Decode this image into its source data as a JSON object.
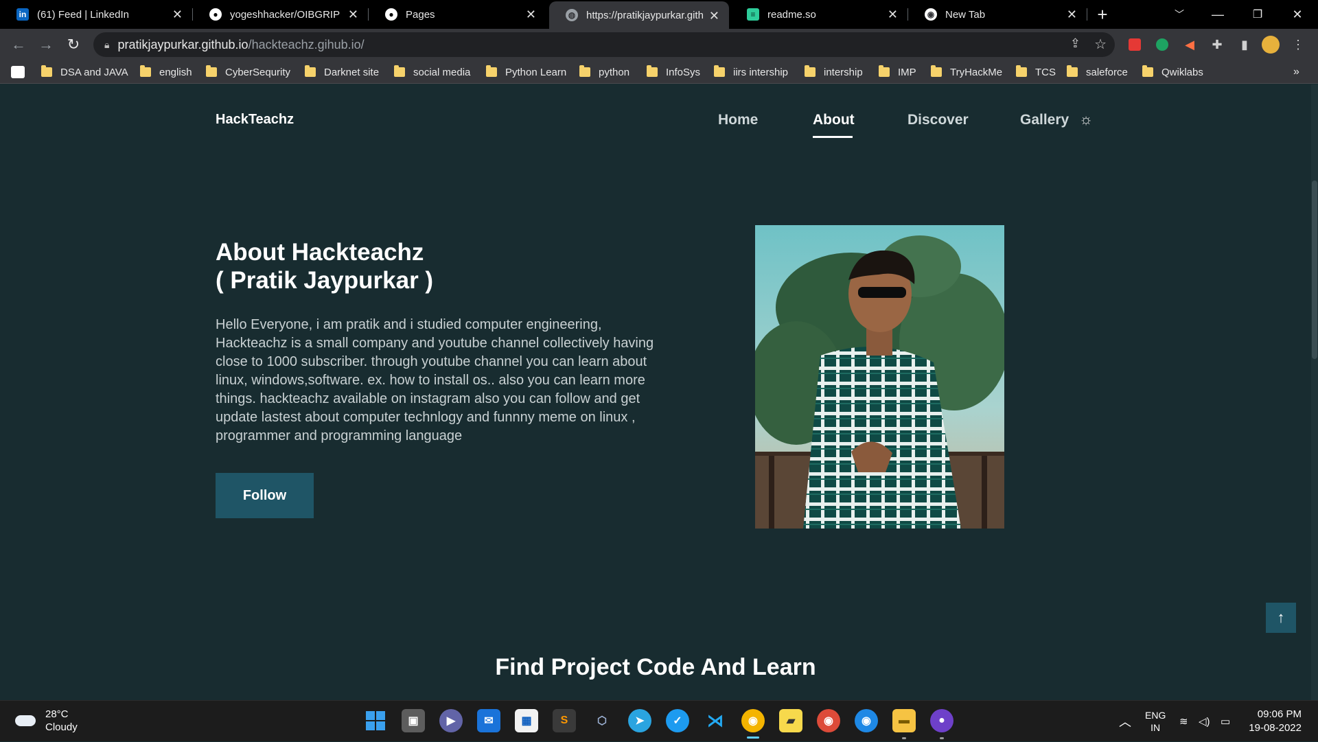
{
  "browser": {
    "tabs": [
      {
        "title": "(61) Feed | LinkedIn",
        "icon": "linkedin-icon"
      },
      {
        "title": "yogeshhacker/OIBGRIP",
        "icon": "github-icon"
      },
      {
        "title": "Pages",
        "icon": "github-icon"
      },
      {
        "title": "https://pratikjaypurkar.github.io/hackteachz.gihub.io/",
        "icon": "globe-icon"
      },
      {
        "title": "readme.so",
        "icon": "readme-icon"
      },
      {
        "title": "New Tab",
        "icon": "chrome-icon"
      }
    ],
    "new_tab_symbol": "+",
    "url_host": "pratikjaypurkar.github.io",
    "url_path": "/hackteachz.gihub.io/",
    "bookmarks": [
      "DSA and JAVA",
      "english",
      "CyberSequrity",
      "Darknet site",
      "social media",
      "Python Learn",
      "python",
      "InfoSys",
      "iirs intership",
      "intership",
      "IMP",
      "TryHackMe",
      "TCS",
      "saleforce",
      "Qwiklabs"
    ],
    "bookmarks_overflow": "»"
  },
  "site": {
    "brand": "HackTeachz",
    "nav": {
      "home": "Home",
      "about": "About",
      "discover": "Discover",
      "gallery": "Gallery"
    },
    "about": {
      "title_line1": "About Hackteachz",
      "title_line2": "( Pratik Jaypurkar )",
      "body": "Hello Everyone, i am pratik and i studied computer engineering, Hackteachz is a small company and youtube channel collectively having close to 1000 subscriber. through youtube channel you can learn about linux, windows,software. ex. how to install os.. also you can learn more things. hackteachz available on instagram also you can follow and get update lastest about computer technlogy and funnny meme on linux , programmer and programming language",
      "follow_label": "Follow"
    },
    "section_title": "Find Project Code And Learn",
    "colors": {
      "background": "#182c30",
      "accent": "#1f5566"
    }
  },
  "taskbar": {
    "weather_temp": "28°C",
    "weather_desc": "Cloudy",
    "lang_line1": "ENG",
    "lang_line2": "IN",
    "time": "09:06 PM",
    "date": "19-08-2022",
    "apps": [
      "windows-start-icon",
      "task-view-icon",
      "teams-chat-icon",
      "mail-icon",
      "microsoft-store-icon",
      "sublime-text-icon",
      "virtualbox-icon",
      "telegram-icon",
      "twitter-icon",
      "vscode-icon",
      "chrome-canary-icon",
      "sticky-notes-icon",
      "chrome-icon",
      "chrome-beta-icon",
      "file-explorer-icon",
      "github-desktop-icon"
    ]
  }
}
